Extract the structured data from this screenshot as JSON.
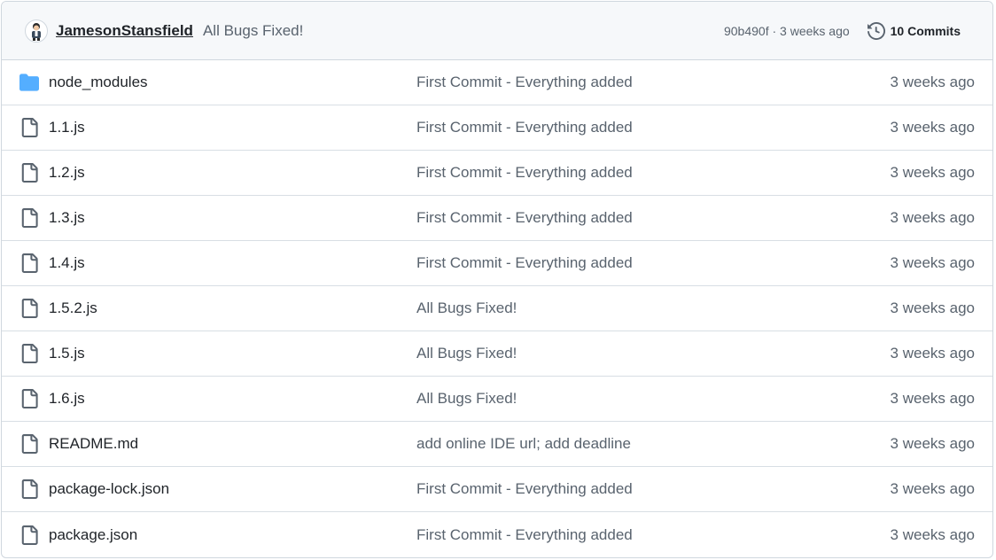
{
  "header": {
    "author": "JamesonStansfield",
    "commit_message": "All Bugs Fixed!",
    "sha_time": "90b490f · 3 weeks ago",
    "commits_label": "10 Commits",
    "icons": {
      "avatar": "user-avatar",
      "history": "history-clock-icon"
    }
  },
  "colors": {
    "folder": "#54aeff",
    "file": "#59636e",
    "border": "#d0d7de",
    "header_bg": "#f6f8fa"
  },
  "files": [
    {
      "name": "node_modules",
      "type": "folder",
      "message": "First Commit - Everything added",
      "time": "3 weeks ago"
    },
    {
      "name": "1.1.js",
      "type": "file",
      "message": "First Commit - Everything added",
      "time": "3 weeks ago"
    },
    {
      "name": "1.2.js",
      "type": "file",
      "message": "First Commit - Everything added",
      "time": "3 weeks ago"
    },
    {
      "name": "1.3.js",
      "type": "file",
      "message": "First Commit - Everything added",
      "time": "3 weeks ago"
    },
    {
      "name": "1.4.js",
      "type": "file",
      "message": "First Commit - Everything added",
      "time": "3 weeks ago"
    },
    {
      "name": "1.5.2.js",
      "type": "file",
      "message": "All Bugs Fixed!",
      "time": "3 weeks ago"
    },
    {
      "name": "1.5.js",
      "type": "file",
      "message": "All Bugs Fixed!",
      "time": "3 weeks ago"
    },
    {
      "name": "1.6.js",
      "type": "file",
      "message": "All Bugs Fixed!",
      "time": "3 weeks ago"
    },
    {
      "name": "README.md",
      "type": "file",
      "message": "add online IDE url; add deadline",
      "time": "3 weeks ago"
    },
    {
      "name": "package-lock.json",
      "type": "file",
      "message": "First Commit - Everything added",
      "time": "3 weeks ago"
    },
    {
      "name": "package.json",
      "type": "file",
      "message": "First Commit - Everything added",
      "time": "3 weeks ago"
    }
  ]
}
